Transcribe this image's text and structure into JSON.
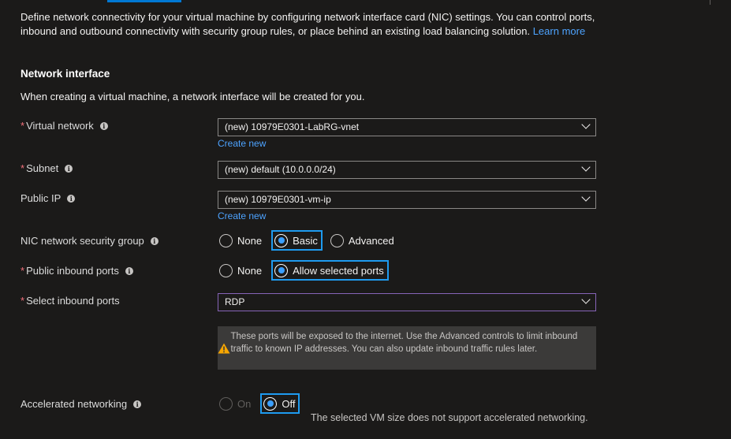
{
  "intro": {
    "text": "Define network connectivity for your virtual machine by configuring network interface card (NIC) settings. You can control ports, inbound and outbound connectivity with security group rules, or place behind an existing load balancing solution. ",
    "learn_more": "Learn more"
  },
  "section": {
    "title": "Network interface",
    "description": "When creating a virtual machine, a network interface will be created for you."
  },
  "fields": {
    "virtual_network": {
      "label": "Virtual network",
      "required": "*",
      "value": "(new) 10979E0301-LabRG-vnet",
      "create_new": "Create new"
    },
    "subnet": {
      "label": "Subnet",
      "required": "*",
      "value": "(new) default (10.0.0.0/24)"
    },
    "public_ip": {
      "label": "Public IP",
      "value": "(new) 10979E0301-vm-ip",
      "create_new": "Create new"
    },
    "nic_nsg": {
      "label": "NIC network security group",
      "options": [
        "None",
        "Basic",
        "Advanced"
      ],
      "selected": "Basic"
    },
    "public_inbound_ports": {
      "label": "Public inbound ports",
      "required": "*",
      "options": [
        "None",
        "Allow selected ports"
      ],
      "selected": "Allow selected ports"
    },
    "select_inbound_ports": {
      "label": "Select inbound ports",
      "required": "*",
      "value": "RDP"
    },
    "accelerated_networking": {
      "label": "Accelerated networking",
      "options": [
        "On",
        "Off"
      ],
      "selected": "Off",
      "note": "The selected VM size does not support accelerated networking."
    }
  },
  "warning": {
    "text": "These ports will be exposed to the internet. Use the Advanced controls to limit inbound traffic to known IP addresses. You can also update inbound traffic rules later."
  },
  "colors": {
    "accent": "#0078d4",
    "highlight": "#1e9bf0",
    "required": "#f1707b",
    "warning": "#f7a600"
  },
  "icons": {
    "info": "info-icon",
    "chevron": "chevron-down-icon",
    "warning": "warning-icon"
  }
}
